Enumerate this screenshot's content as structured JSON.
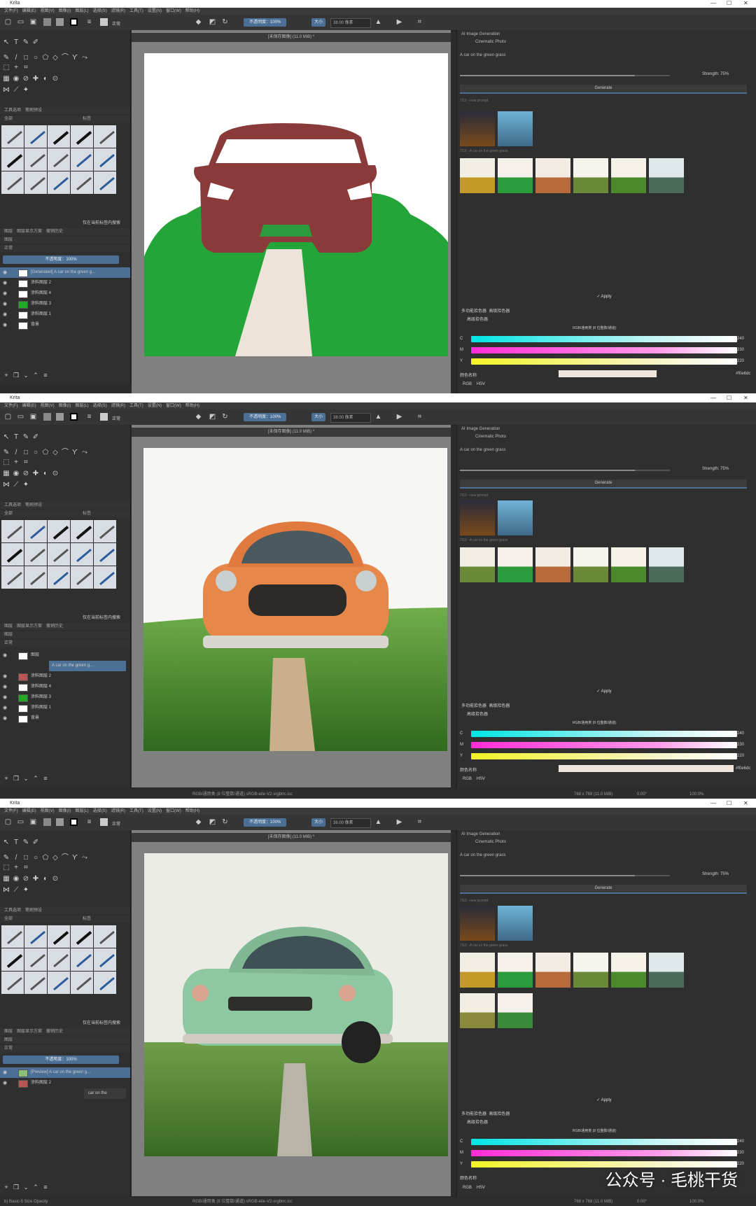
{
  "app": {
    "title": "Krita",
    "window_controls": [
      "—",
      "☐",
      "✕"
    ]
  },
  "menu": [
    "文件(F)",
    "编辑(E)",
    "视图(V)",
    "图像(I)",
    "图层(L)",
    "选择(S)",
    "滤镜(R)",
    "工具(T)",
    "设置(N)",
    "窗口(W)",
    "帮助(H)"
  ],
  "toolbar": {
    "blend_mode": "正常",
    "opacity": "不透明度：100%",
    "size_label": "大小",
    "size_value": "38.00 像素"
  },
  "doc_tab": "[未保存图像]  (11.0 MiB) *",
  "left_dock": {
    "tab_tools": "工具选项",
    "tab_brush": "笔刷预设",
    "filter_all": "全部",
    "tag": "标签",
    "layers_title": "图层",
    "layers_tabs": [
      "图层",
      "图层显示方案",
      "撤销历史"
    ],
    "layer_blend": "正常",
    "layer_opacity": "不透明度：100%",
    "pressure_label": "仅在当前标签内搜索"
  },
  "shots": [
    {
      "layers": [
        "[Generated] A car on the green g...",
        "涂料图层 2",
        "涂料图层 4",
        "涂料图层 3",
        "涂料图层 1",
        "背景"
      ],
      "selected_layer": 0
    },
    {
      "layers": [
        "图层",
        "A car on the green g...",
        "涂料图层 2",
        "涂料图层 4",
        "涂料图层 3",
        "涂料图层 1",
        "背景"
      ],
      "selected_layer": 1
    },
    {
      "layers": [
        "[Preview] A car on the green g...",
        "涂料图层 2",
        "car on the"
      ],
      "selected_layer": 0
    }
  ],
  "ai_panel": {
    "title": "AI Image Generation",
    "style": "Cinematic Photo",
    "prompt": "A car on the green grass",
    "strength": "Strength: 75%",
    "generate": "Generate",
    "history_label_1": "7/10 - new prompt",
    "history_label_2": "7/10 - A car on the green grass",
    "apply": "✓ Apply"
  },
  "color_panel": {
    "tabs": [
      "多功能拾色器",
      "高级拾色器"
    ],
    "title": "高级拾色器",
    "space": "RGB/通用类 (8 位整数/通道)",
    "channel_labels": [
      "C",
      "M",
      "Y"
    ],
    "channel_values": [
      "240",
      "230",
      "220"
    ],
    "hex_label": "颜色名称",
    "hex_value": "#f0e6dc",
    "model_tabs": [
      "RGB",
      "HSV"
    ],
    "colors": {
      "cyan": "#00e5e5",
      "magenta": "#ff2cd7",
      "yellow": "#f3f326"
    }
  },
  "status": {
    "brush": "b) Basic-5 Size Opacity",
    "profile": "RGB/通用类 (8 位整数/通道)  sRGB-elle-V2-srgbtrc.icc",
    "size": "768 x 768 (11.0 MiB)",
    "rotation": "0.00°",
    "zoom": "100.0%"
  },
  "watermark": "公众号 · 毛桃干货",
  "accent": "#4b6f95"
}
